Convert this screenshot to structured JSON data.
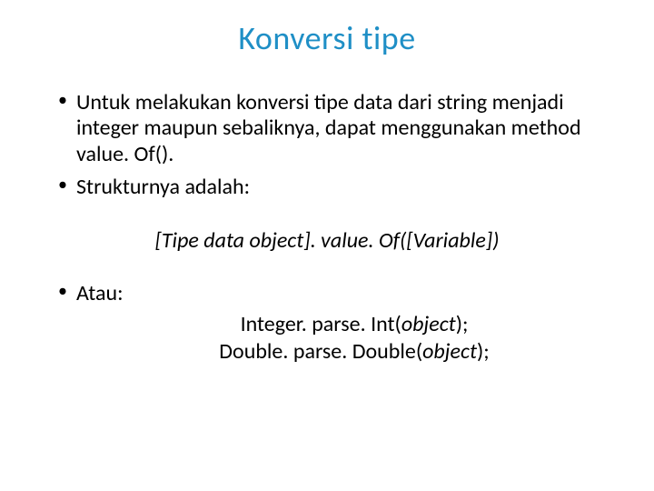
{
  "title": "Konversi tipe",
  "bullets": {
    "item1": "Untuk melakukan konversi tipe data dari string menjadi integer maupun sebaliknya, dapat menggunakan method value. Of().",
    "item2": "Strukturnya adalah:"
  },
  "codeStructure": "[Tipe data object]. value. Of([Variable])",
  "atauLabel": "Atau:",
  "parse": {
    "int_prefix": "Integer. parse. Int(",
    "int_arg": "object",
    "int_suffix": ");",
    "double_prefix": "Double. parse. Double(",
    "double_arg": "object",
    "double_suffix": ");"
  }
}
